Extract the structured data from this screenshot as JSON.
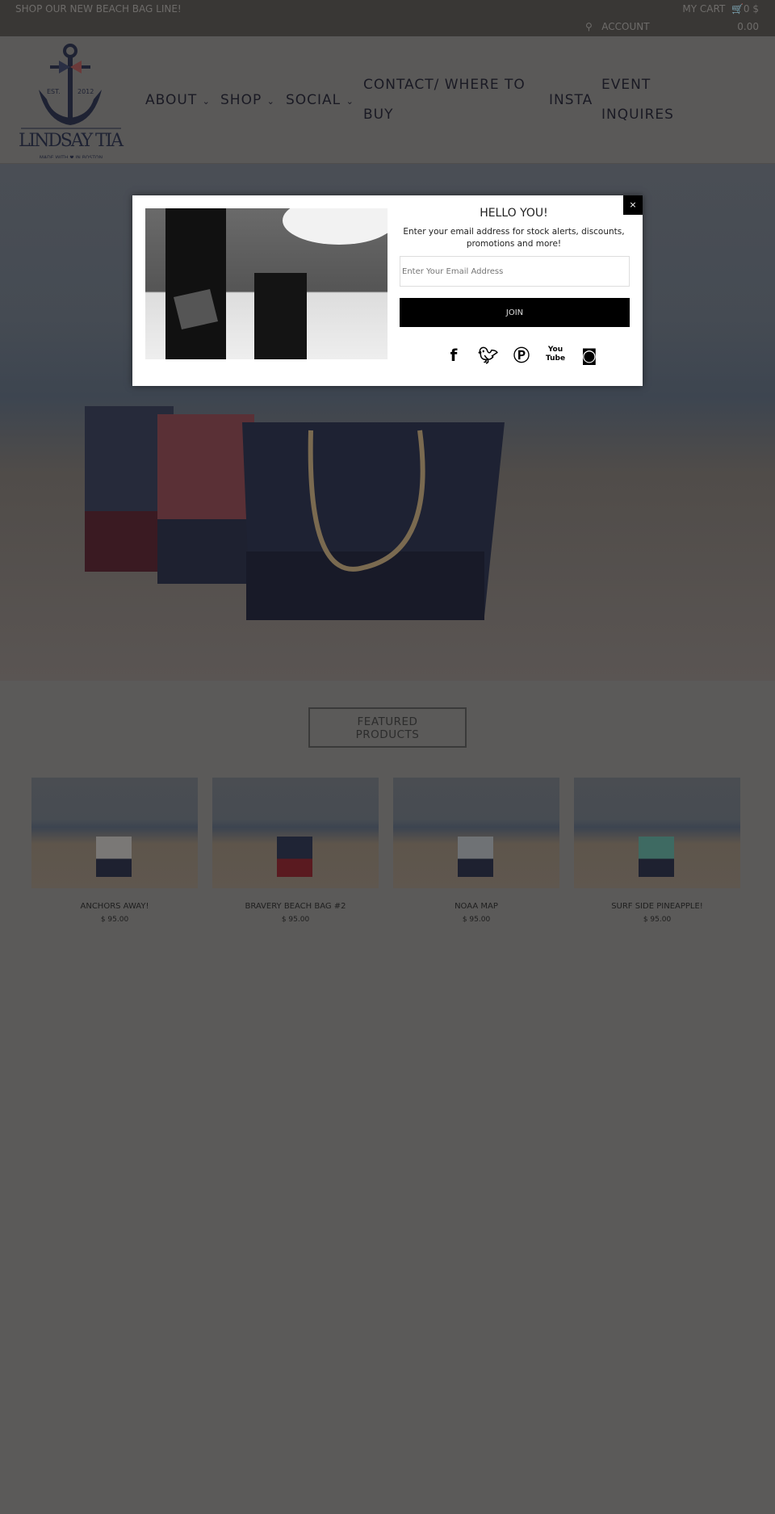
{
  "topbar": {
    "promo": "SHOP OUR NEW BEACH BAG LINE!",
    "cart_label": "MY CART",
    "cart_count": "0",
    "currency": "$",
    "account": "ACCOUNT",
    "cart_total": "0.00"
  },
  "logo": {
    "text": "LINDSAY TIA",
    "est": "EST. 2012",
    "tagline": "MADE WITH ♥ IN BOSTON"
  },
  "nav": [
    {
      "label": "ABOUT"
    },
    {
      "label": "SHOP"
    },
    {
      "label": "SOCIAL"
    },
    {
      "line1": "CONTACT/ WHERE TO",
      "line2": "BUY"
    },
    {
      "label": "INSTA"
    },
    {
      "line1": "EVENT",
      "line2": "INQUIRES"
    }
  ],
  "modal": {
    "title": "HELLO YOU!",
    "text": "Enter your email address for stock alerts, discounts, promotions and more!",
    "email_placeholder": "Enter Your Email Address",
    "join": "JOIN",
    "close": "×",
    "socials": [
      "facebook-icon",
      "twitter-icon",
      "pinterest-icon",
      "youtube-icon",
      "instagram-icon"
    ]
  },
  "featured": {
    "line1": "FEATURED",
    "line2": "PRODUCTS"
  },
  "products": [
    {
      "title": "ANCHORS AWAY!",
      "price": "$ 95.00",
      "bag_top": "#7a7876",
      "bag_bottom": "#1e2130"
    },
    {
      "title": "BRAVERY BEACH BAG #2",
      "price": "$ 95.00",
      "bag_top": "#1f2435",
      "bag_bottom": "#5a1a20"
    },
    {
      "title": "NOAA MAP",
      "price": "$ 95.00",
      "bag_top": "#6f7275",
      "bag_bottom": "#1e2130"
    },
    {
      "title": "SURF SIDE PINEAPPLE!",
      "price": "$ 95.00",
      "bag_top": "#3e6a62",
      "bag_bottom": "#1e2130"
    }
  ],
  "colors": {
    "overlay_bg": "#5b5a59",
    "topbar": "#393735",
    "nav_text": "#1a1a24",
    "button": "#000000"
  }
}
